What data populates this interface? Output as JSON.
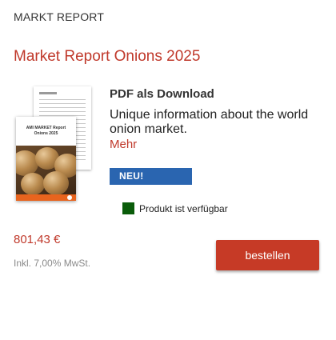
{
  "header": {
    "section_label": "MARKT REPORT"
  },
  "product": {
    "title": "Market Report Onions 2025",
    "download_heading": "PDF als Download",
    "description": "Unique information about the world onion market.",
    "more_link": "Mehr",
    "badge": "NEU!",
    "availability": "Produkt ist verfügbar",
    "price": "801,43 €",
    "vat_note": "Inkl. 7,00% MwSt.",
    "order_button": "bestellen"
  },
  "thumbnail": {
    "cover_title_line1": "AMI MARKET Report",
    "cover_title_line2": "Onions 2025",
    "back_page_heading": "1. Market"
  },
  "colors": {
    "accent_red": "#c0392b",
    "button_red": "#c63a26",
    "badge_blue": "#2a65b0",
    "availability_green": "#0a5c0a",
    "cover_orange": "#e8641e"
  },
  "icons": {
    "availability": "availability-square-icon"
  }
}
